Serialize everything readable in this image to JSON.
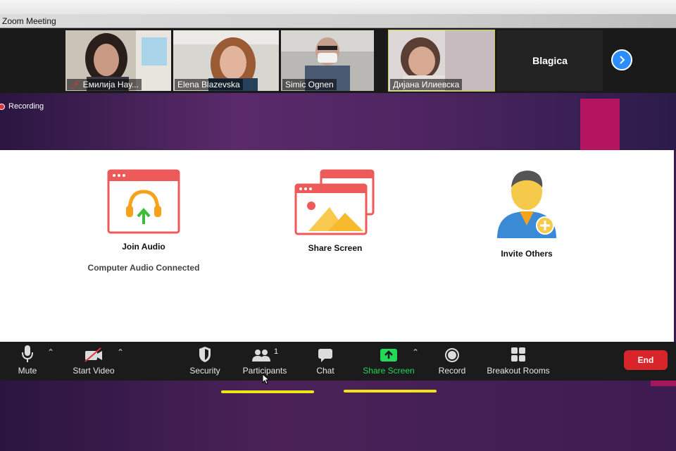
{
  "window": {
    "title": "Zoom Meeting"
  },
  "participants_strip": {
    "tiles": [
      {
        "name": "Емилија Нау...",
        "muted": true
      },
      {
        "name": "Elena Blazevska"
      },
      {
        "name": "Simic Ognen"
      },
      {
        "name": "Дијана Илиевска",
        "active": true
      }
    ],
    "name_only_tile": "Blagica",
    "next_icon": "chevron-right-icon"
  },
  "recording": {
    "label": "Recording"
  },
  "dialog": {
    "join_audio": {
      "label": "Join Audio",
      "status": "Computer Audio Connected"
    },
    "share_screen": {
      "label": "Share Screen"
    },
    "invite_others": {
      "label": "Invite Others"
    }
  },
  "toolbar": {
    "mute": "Mute",
    "start_video": "Start Video",
    "security": "Security",
    "participants": "Participants",
    "participants_count": "1",
    "chat": "Chat",
    "share_screen": "Share Screen",
    "record": "Record",
    "breakout_rooms": "Breakout Rooms",
    "end": "End"
  },
  "colors": {
    "accent": "#2d8cff",
    "share_green": "#23d959",
    "end_red": "#d7252b",
    "highlight_yellow": "#f2e21a",
    "icon_red": "#ee5a5a",
    "icon_orange": "#f7a21b"
  }
}
